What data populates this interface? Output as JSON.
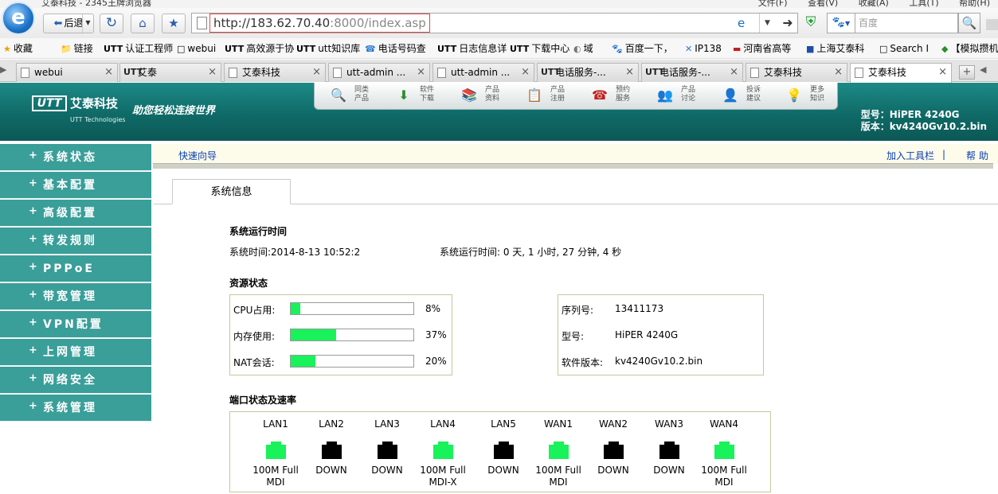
{
  "browser": {
    "window_title": "艾泰科技 - 2345王牌浏览器",
    "menu": [
      "文件(F)",
      "查看(V)",
      "收藏(A)",
      "工具(T)",
      "帮助(H)"
    ],
    "back_label": "后退",
    "url_host": "http://183.62.70.40",
    "url_rest": ":8000/index.asp",
    "search_placeholder": "百度",
    "bookmarks": [
      {
        "icon": "★",
        "label": "收藏"
      },
      {
        "icon": "📁",
        "label": "链接"
      },
      {
        "icon": "UTT",
        "label": "认证工程师"
      },
      {
        "icon": "□",
        "label": "webui"
      },
      {
        "icon": "UTT",
        "label": "高效源于协"
      },
      {
        "icon": "UTT",
        "label": "utt知识库"
      },
      {
        "icon": "☎",
        "label": "电话号码查"
      },
      {
        "icon": "UTT",
        "label": "日志信息详"
      },
      {
        "icon": "UTT",
        "label": "下载中心"
      },
      {
        "icon": "◐",
        "label": "域"
      },
      {
        "icon": "🐾",
        "label": "百度一下，"
      },
      {
        "icon": "✕",
        "label": "IP138"
      },
      {
        "icon": "▬",
        "label": "河南省高等"
      },
      {
        "icon": "■",
        "label": "上海艾泰科"
      },
      {
        "icon": "□",
        "label": "Search I"
      },
      {
        "icon": "◆",
        "label": "【模拟攒机"
      }
    ],
    "tabs": [
      {
        "icon": "page",
        "label": "webui",
        "active": false
      },
      {
        "icon": "utt",
        "label": "艾泰",
        "active": false
      },
      {
        "icon": "page",
        "label": "艾泰科技",
        "active": false
      },
      {
        "icon": "page",
        "label": "utt-admin ...",
        "active": false
      },
      {
        "icon": "page",
        "label": "utt-admin ...",
        "active": false
      },
      {
        "icon": "utt",
        "label": "电话服务-...",
        "active": false
      },
      {
        "icon": "utt",
        "label": "电话服务-...",
        "active": false
      },
      {
        "icon": "page",
        "label": "艾泰科技",
        "active": false
      },
      {
        "icon": "page",
        "label": "艾泰科技",
        "active": true
      }
    ]
  },
  "header": {
    "logo_text": "UTT",
    "company": "艾泰科技",
    "company_en": "UTT Technologies",
    "slogan": "助您轻松连接世界",
    "nav": [
      {
        "icon": "search-icon",
        "glyph": "🔍",
        "label": "同类\n产品"
      },
      {
        "icon": "download-icon",
        "glyph": "⬇",
        "label": "软件\n下载"
      },
      {
        "icon": "book-icon",
        "glyph": "📚",
        "label": "产品\n资料"
      },
      {
        "icon": "register-icon",
        "glyph": "📋",
        "label": "产品\n注册"
      },
      {
        "icon": "phone-icon",
        "glyph": "☎",
        "label": "预约\n服务"
      },
      {
        "icon": "people-icon",
        "glyph": "👥",
        "label": "产品\n讨论"
      },
      {
        "icon": "complaint-icon",
        "glyph": "👤",
        "label": "投诉\n建议"
      },
      {
        "icon": "knowledge-icon",
        "glyph": "💡",
        "label": "更多\n知识"
      }
    ],
    "model_line": "型号：HiPER 4240G",
    "version_line": "版本：kv4240Gv10.2.bin"
  },
  "sidebar": {
    "items": [
      "系统状态",
      "基本配置",
      "高级配置",
      "转发规则",
      "PPPoE",
      "带宽管理",
      "VPN配置",
      "上网管理",
      "网络安全",
      "系统管理"
    ]
  },
  "subheader": {
    "quick_wizard": "快速向导",
    "add_toolbar": "加入工具栏",
    "separator": "|",
    "help": "帮助"
  },
  "tab_sysinfo": "系统信息",
  "runtime": {
    "title": "系统运行时间",
    "system_time": "系统时间:2014-8-13 10:52:2",
    "uptime": "系统运行时间: 0 天, 1 小时, 27 分钟, 4 秒"
  },
  "resources": {
    "title": "资源状态",
    "items": [
      {
        "label": "CPU占用:",
        "percent": 8,
        "text": "8%"
      },
      {
        "label": "内存使用:",
        "percent": 37,
        "text": "37%"
      },
      {
        "label": "NAT会话:",
        "percent": 20,
        "text": "20%"
      }
    ],
    "bar_color": "#19f25a"
  },
  "device": {
    "serial_label": "序列号:",
    "serial": "13411173",
    "model_label": "型号:",
    "model": "HiPER 4240G",
    "version_label": "软件版本:",
    "version": "kv4240Gv10.2.bin"
  },
  "ports": {
    "title": "端口状态及速率",
    "up_color": "#19f25a",
    "down_color": "#000000",
    "items": [
      {
        "name": "LAN1",
        "up": true,
        "status": "100M Full\nMDI"
      },
      {
        "name": "LAN2",
        "up": false,
        "status": "DOWN"
      },
      {
        "name": "LAN3",
        "up": false,
        "status": "DOWN"
      },
      {
        "name": "LAN4",
        "up": true,
        "status": "100M Full\nMDI-X"
      },
      {
        "name": "LAN5",
        "up": false,
        "status": "DOWN"
      },
      {
        "name": "WAN1",
        "up": true,
        "status": "100M Full\nMDI"
      },
      {
        "name": "WAN2",
        "up": false,
        "status": "DOWN"
      },
      {
        "name": "WAN3",
        "up": false,
        "status": "DOWN"
      },
      {
        "name": "WAN4",
        "up": true,
        "status": "100M Full\nMDI"
      }
    ]
  }
}
